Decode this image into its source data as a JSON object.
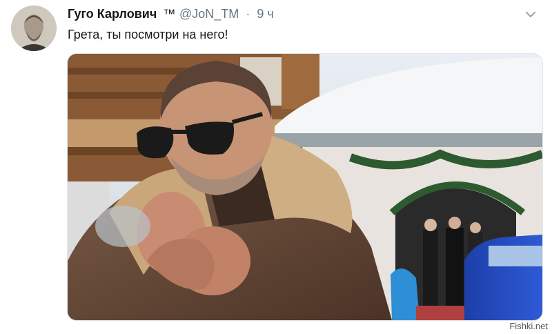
{
  "tweet": {
    "author_name": "Гуго Карлович",
    "author_badge": "™",
    "handle": "@JoN_TM",
    "separator": "·",
    "time": "9 ч",
    "text": "Грета, ты посмотри на него!",
    "icons": {
      "avatar": "author-portrait",
      "menu": "chevron-down-icon"
    }
  },
  "watermark": "Fishki.net",
  "colors": {
    "name": "#14171a",
    "meta": "#657786",
    "border": "#e1e8ed"
  }
}
